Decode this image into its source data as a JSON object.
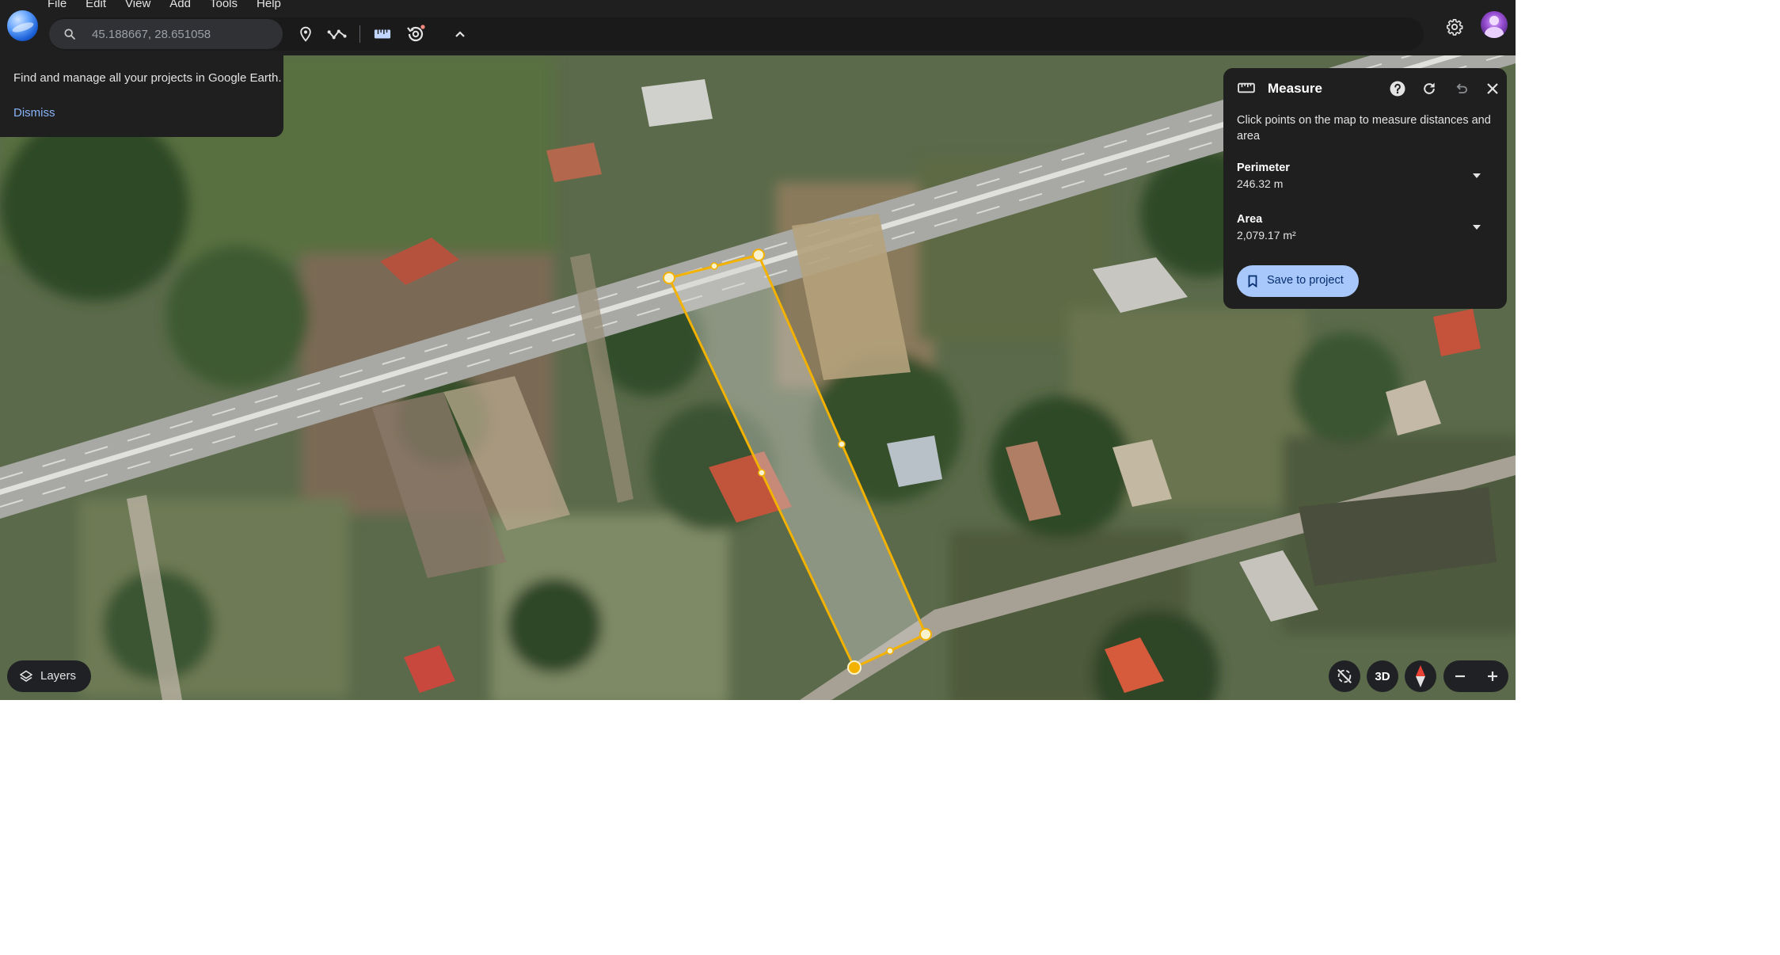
{
  "menu": [
    "File",
    "Edit",
    "View",
    "Add",
    "Tools",
    "Help"
  ],
  "search": {
    "value": "45.188667, 28.651058",
    "icon": "search-icon"
  },
  "toolbar": {
    "icons": [
      "placemark-icon",
      "path-icon",
      "ruler-icon",
      "history-icon",
      "collapse-icon"
    ]
  },
  "tip": {
    "text": "Find and manage all your projects in Google Earth.",
    "dismiss": "Dismiss"
  },
  "measure": {
    "title": "Measure",
    "instruction": "Click points on the map to measure distances and area",
    "perimeter_label": "Perimeter",
    "perimeter_value": "246.32 m",
    "area_label": "Area",
    "area_value": "2,079.17 m²",
    "save_label": "Save to project"
  },
  "layers_label": "Layers",
  "view_3d_label": "3D",
  "colors": {
    "panel": "#1f1f1f",
    "accent": "#a8c7fa",
    "link": "#8ab4f8",
    "polygon": "#f3b200"
  }
}
